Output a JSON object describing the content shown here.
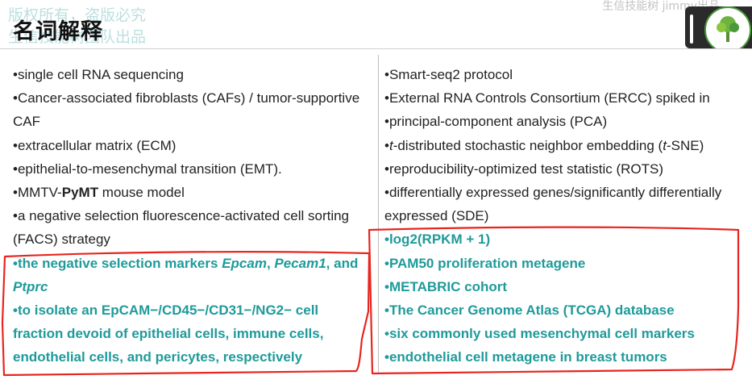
{
  "watermark": {
    "line1": "版权所有，盗版必究",
    "line2": "生信技能树团队出品"
  },
  "header": {
    "title": "名词解释",
    "topright": "生信技能树 jimmy出品"
  },
  "colors": {
    "highlight": "#1f9a9a",
    "annotation": "#e8251f"
  },
  "left": [
    {
      "text": "•single cell RNA sequencing",
      "hl": false
    },
    {
      "text": "•Cancer-associated fibroblasts (CAFs) / tumor-supportive CAF",
      "hl": false
    },
    {
      "text": "•extracellular matrix (ECM)",
      "hl": false
    },
    {
      "text": "•epithelial-to-mesenchymal transition (EMT).",
      "hl": false
    },
    {
      "html": "•MMTV-<b>PyMT</b> mouse model",
      "hl": false
    },
    {
      "text": "•a negative selection fluorescence-activated cell sorting (FACS) strategy",
      "hl": false
    },
    {
      "html": "•the negative selection markers <i>Epcam</i>, <i>Pecam1</i>, and <i>Ptprc</i>",
      "hl": true
    },
    {
      "text": "•to isolate an EpCAM−/CD45−/CD31−/NG2− cell fraction devoid of epithelial cells, immune cells, endothelial cells, and pericytes, respectively",
      "hl": true
    }
  ],
  "right": [
    {
      "text": "•Smart-seq2 protocol",
      "hl": false
    },
    {
      "text": "•External RNA Controls Consortium (ERCC) spiked in",
      "hl": false
    },
    {
      "text": "•principal-component analysis (PCA)",
      "hl": false
    },
    {
      "html": "•<i>t</i>-distributed stochastic neighbor embedding (<i>t</i>-SNE)",
      "hl": false
    },
    {
      "text": "•reproducibility-optimized test statistic (ROTS)",
      "hl": false
    },
    {
      "text": "•differentially expressed genes/significantly differentially expressed (SDE)",
      "hl": false
    },
    {
      "text": "•log2(RPKM + 1)",
      "hl": true
    },
    {
      "text": "•PAM50 proliferation metagene",
      "hl": true
    },
    {
      "text": "•METABRIC cohort",
      "hl": true
    },
    {
      "text": "•The Cancer Genome Atlas (TCGA) database",
      "hl": true
    },
    {
      "text": "•six commonly used mesenchymal cell markers",
      "hl": true
    },
    {
      "text": "•endothelial cell metagene in breast tumors",
      "hl": true
    }
  ]
}
